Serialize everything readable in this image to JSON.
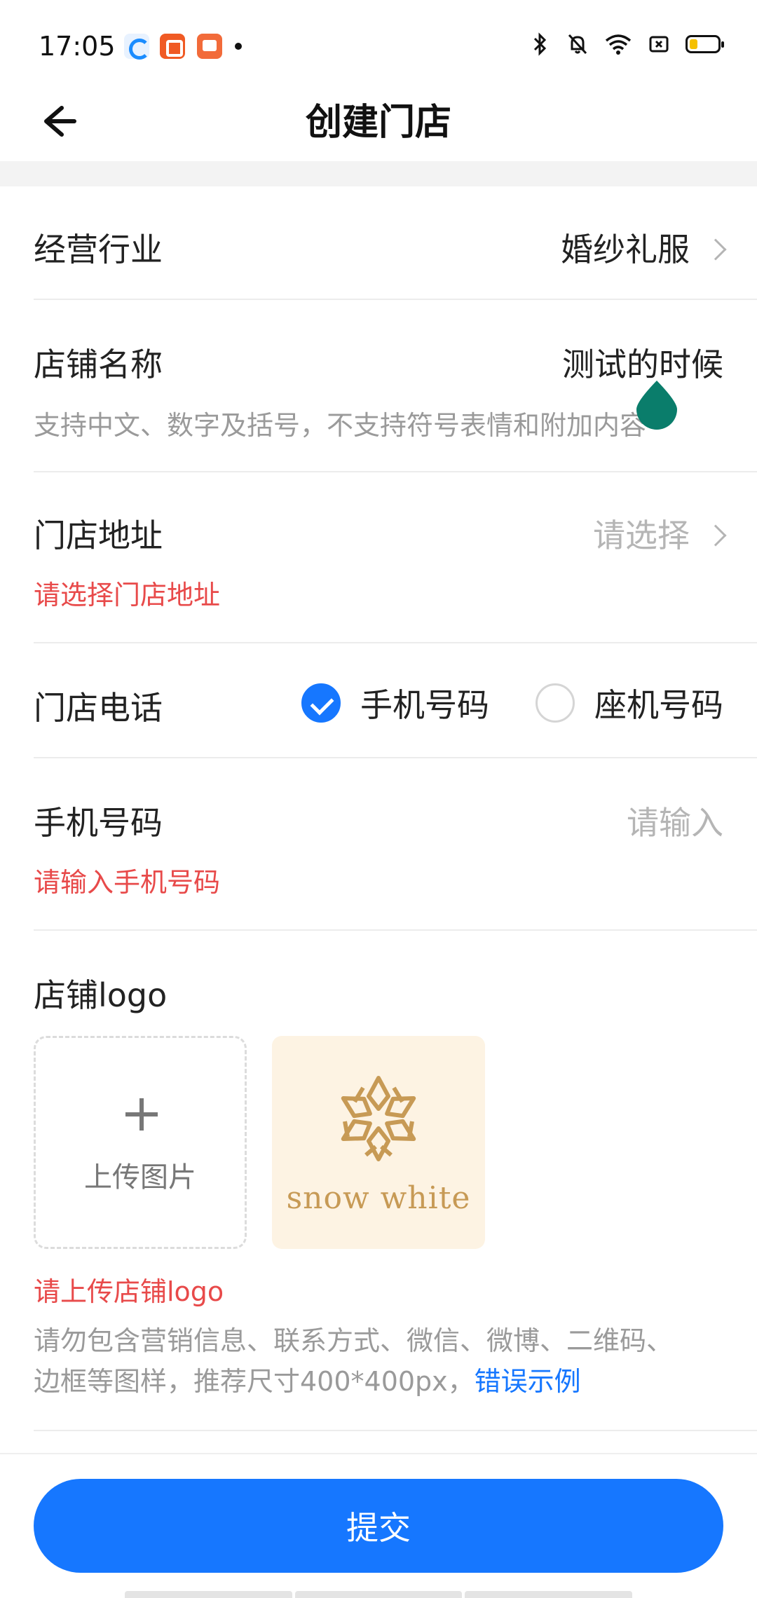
{
  "status_bar": {
    "time": "17:05",
    "notification_icons": [
      "browser-icon",
      "app-icon",
      "book-icon"
    ],
    "system_icons": [
      "bluetooth-icon",
      "mute-icon",
      "wifi-icon",
      "sim-icon",
      "battery-icon"
    ],
    "battery_color": "#f5c000"
  },
  "header": {
    "title": "创建门店",
    "back_icon": "arrow-left-icon"
  },
  "form": {
    "industry": {
      "label": "经营行业",
      "value": "婚纱礼服"
    },
    "store_name": {
      "label": "店铺名称",
      "value": "测试的时候",
      "hint": "支持中文、数字及括号，不支持符号表情和附加内容"
    },
    "address": {
      "label": "门店地址",
      "placeholder": "请选择",
      "error": "请选择门店地址"
    },
    "phone": {
      "label": "门店电话",
      "options": [
        {
          "label": "手机号码",
          "checked": true
        },
        {
          "label": "座机号码",
          "checked": false
        }
      ]
    },
    "mobile": {
      "label": "手机号码",
      "placeholder": "请输入",
      "error": "请输入手机号码"
    },
    "logo": {
      "label": "店铺logo",
      "upload_label": "上传图片",
      "thumb_text": "snow white",
      "error": "请上传店铺logo",
      "hint_line1": "请勿包含营销信息、联系方式、微信、微博、二维码、",
      "hint_line2": "边框等图样，推荐尺寸400*400px，",
      "hint_link": "错误示例"
    }
  },
  "submit_label": "提交",
  "colors": {
    "primary": "#1677ff",
    "error": "#e84a4a",
    "placeholder": "#b5b5b5",
    "cursor_handle": "#0a7d6b"
  }
}
